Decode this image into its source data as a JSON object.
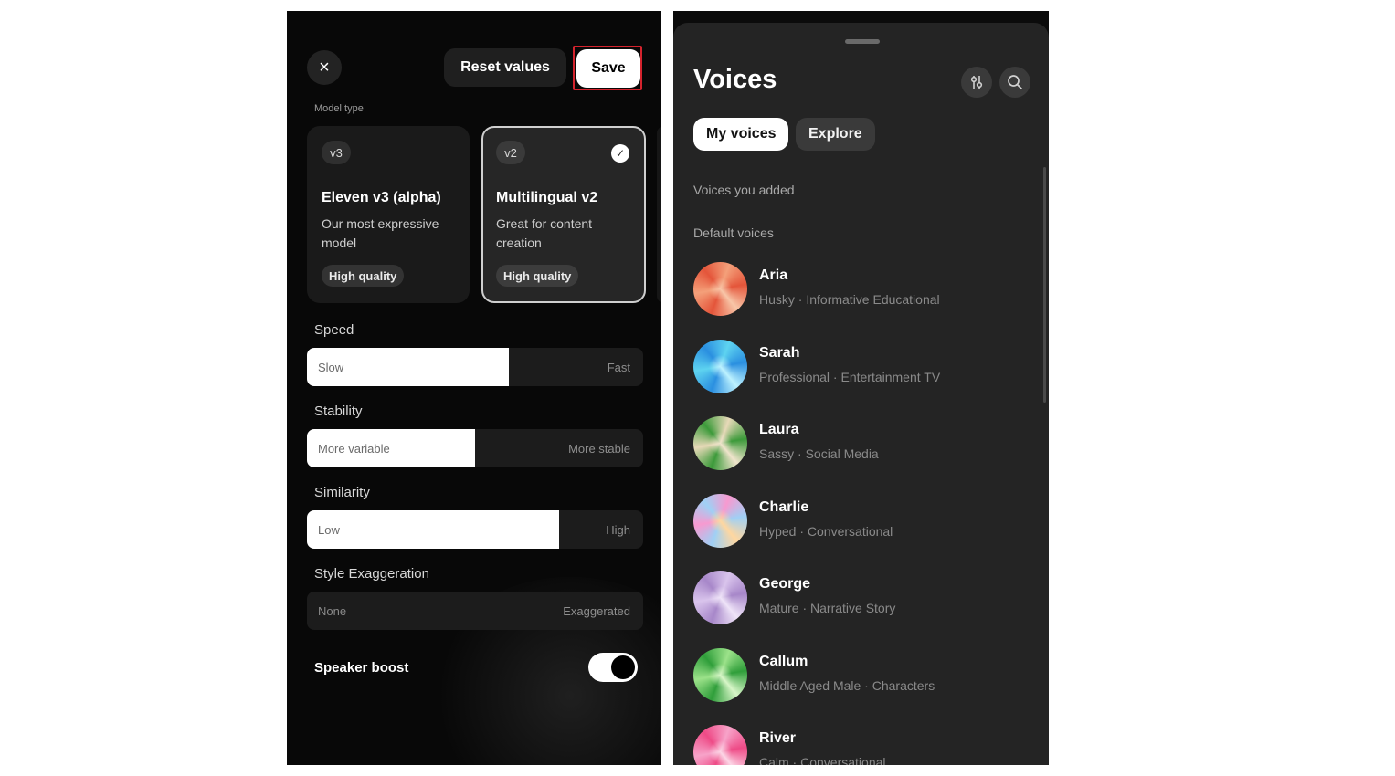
{
  "settings": {
    "close_icon": "×",
    "reset_label": "Reset values",
    "save_label": "Save",
    "model_type_label": "Model type",
    "models": [
      {
        "version": "v3",
        "name": "Eleven v3 (alpha)",
        "description": "Our most expressive model",
        "quality": "High quality",
        "selected": false
      },
      {
        "version": "v2",
        "name": "Multilingual v2",
        "description": "Great for content creation",
        "quality": "High quality",
        "selected": true
      }
    ],
    "speed": {
      "title": "Speed",
      "low": "Slow",
      "high": "Fast",
      "value_fraction": 0.6
    },
    "stability": {
      "title": "Stability",
      "low": "More variable",
      "high": "More stable",
      "value_fraction": 0.5
    },
    "similarity": {
      "title": "Similarity",
      "low": "Low",
      "high": "High",
      "value_fraction": 0.75
    },
    "style": {
      "title": "Style Exaggeration",
      "low": "None",
      "high": "Exaggerated",
      "value_fraction": 0
    },
    "speaker_boost": {
      "label": "Speaker boost",
      "enabled": true
    }
  },
  "voices": {
    "title": "Voices",
    "tabs": [
      "My voices",
      "Explore"
    ],
    "added_label": "Voices you added",
    "default_label": "Default voices",
    "list": [
      {
        "name": "Aria",
        "description": "Husky · Informative Educational",
        "colors": [
          "#f4a07a",
          "#e4553a",
          "#f8c6a8"
        ]
      },
      {
        "name": "Sarah",
        "description": "Professional · Entertainment TV",
        "colors": [
          "#5ed3f0",
          "#2a8fe0",
          "#bdf2ff"
        ]
      },
      {
        "name": "Laura",
        "description": "Sassy · Social Media",
        "colors": [
          "#e7d9b8",
          "#3c9a3a",
          "#f0e4cc"
        ]
      },
      {
        "name": "Charlie",
        "description": "Hyped · Conversational",
        "colors": [
          "#f79ad0",
          "#9fd0f5",
          "#ffd7a0"
        ]
      },
      {
        "name": "George",
        "description": "Mature · Narrative Story",
        "colors": [
          "#d9c4ec",
          "#a787c9",
          "#efe4f8"
        ]
      },
      {
        "name": "Callum",
        "description": "Middle Aged  Male · Characters",
        "colors": [
          "#9ce28a",
          "#2f9e3a",
          "#d8f6c8"
        ]
      },
      {
        "name": "River",
        "description": "Calm · Conversational",
        "colors": [
          "#f7a3c9",
          "#ee4a86",
          "#fcd6e6"
        ]
      }
    ]
  }
}
